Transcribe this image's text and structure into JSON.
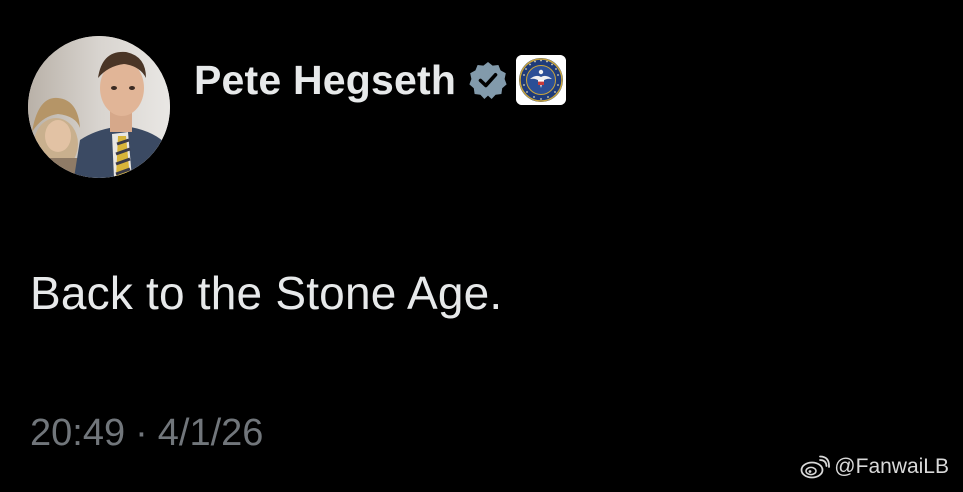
{
  "author": {
    "display_name": "Pete Hegseth",
    "verified_icon": "verified-badge-icon",
    "affiliate_icon": "department-of-war-seal-icon"
  },
  "tweet": {
    "text": "Back to the Stone Age.",
    "time": "20:49",
    "separator": "·",
    "date": "4/1/26"
  },
  "watermark": {
    "icon": "weibo-icon",
    "handle": "@FanwaiLB"
  },
  "colors": {
    "background": "#000000",
    "primary_text": "#e7e9ea",
    "secondary_text": "#71767b",
    "verified_badge": "#829aab"
  }
}
